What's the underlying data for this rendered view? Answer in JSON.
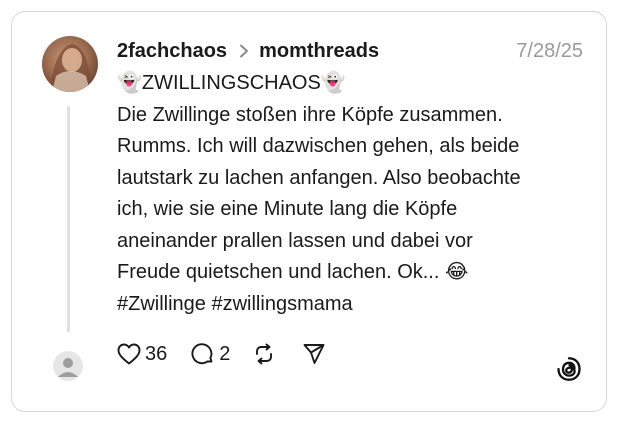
{
  "post": {
    "username": "2fachchaos",
    "community": "momthreads",
    "date": "7/28/25",
    "lines": [
      "👻ZWILLINGSCHAOS👻",
      "Die Zwillinge stoßen ihre Köpfe zusammen.",
      "Rumms. Ich will dazwischen gehen, als beide",
      "lautstark zu lachen anfangen. Also beobachte",
      "ich, wie sie eine Minute lang die Köpfe",
      "aneinander prallen lassen und dabei vor",
      "Freude quietschen und lachen. Ok... 😂",
      "#Zwillinge #zwillingsmama"
    ]
  },
  "actions": {
    "likes": "36",
    "replies": "2"
  },
  "icons": {
    "like": "heart-icon",
    "reply": "comment-icon",
    "repost": "repost-icon",
    "share": "send-icon",
    "brand": "threads-logo-icon"
  },
  "colors": {
    "text": "#1a1a1a",
    "muted": "#9a9a9a",
    "border": "#d6d6d6",
    "thread_line": "#e0e0e0"
  }
}
